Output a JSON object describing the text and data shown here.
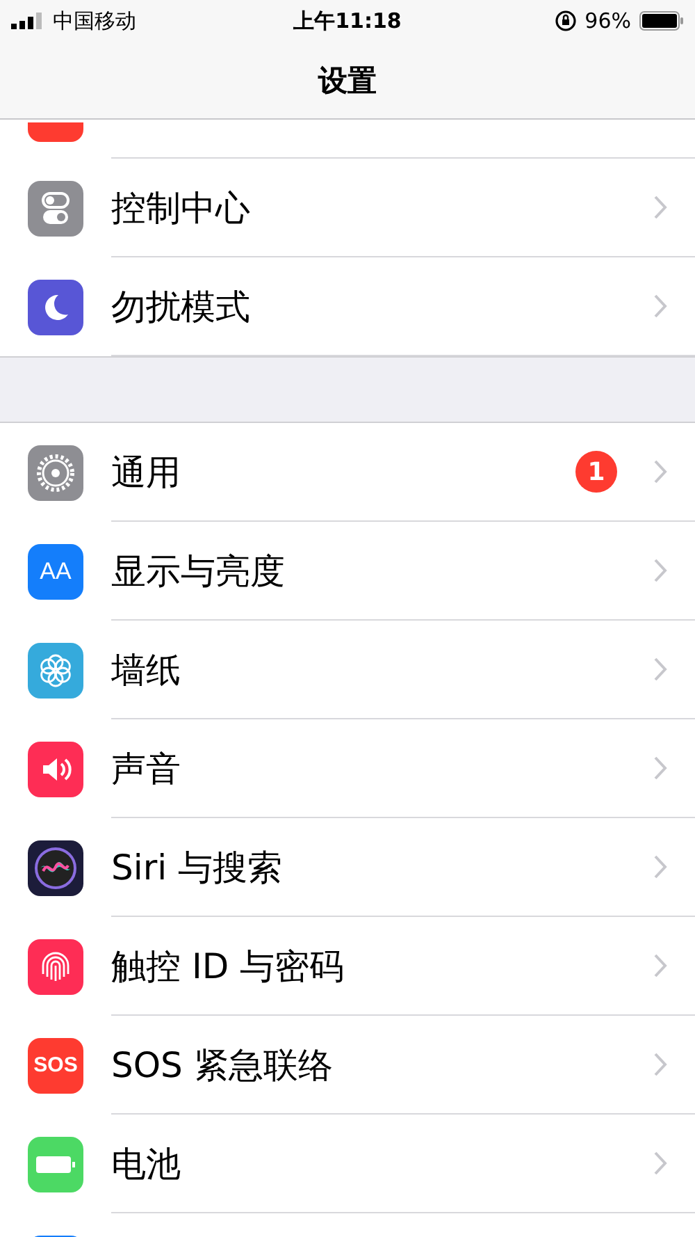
{
  "status_bar": {
    "carrier": "中国移动",
    "time": "上午11:18",
    "battery": "96%"
  },
  "nav": {
    "title": "设置"
  },
  "top_partial_row": {
    "color": "#fe3b30"
  },
  "groups": [
    {
      "rows": [
        {
          "label": "控制中心",
          "kind": "toggles",
          "color": "#8e8e93"
        },
        {
          "label": "勿扰模式",
          "kind": "moon",
          "color": "#5856d6"
        }
      ]
    },
    {
      "rows": [
        {
          "label": "通用",
          "kind": "gear",
          "color": "#8e8e93",
          "badge": "1"
        },
        {
          "label": "显示与亮度",
          "kind": "text",
          "icon_text": "AA",
          "color": "#147efb"
        },
        {
          "label": "墙纸",
          "kind": "flower",
          "color": "#35aadc"
        },
        {
          "label": "声音",
          "kind": "speaker",
          "color": "#fe2d55"
        },
        {
          "label": "Siri 与搜索",
          "kind": "siri",
          "color": "#1c1c3a"
        },
        {
          "label": "触控 ID 与密码",
          "kind": "fingerprint",
          "color": "#fe2d55"
        },
        {
          "label": "SOS 紧急联络",
          "kind": "text",
          "icon_text": "SOS",
          "color": "#fe3b30"
        },
        {
          "label": "电池",
          "kind": "battery",
          "color": "#4cd964"
        }
      ]
    }
  ],
  "bottom_partial_row": {
    "color": "#147efb"
  }
}
